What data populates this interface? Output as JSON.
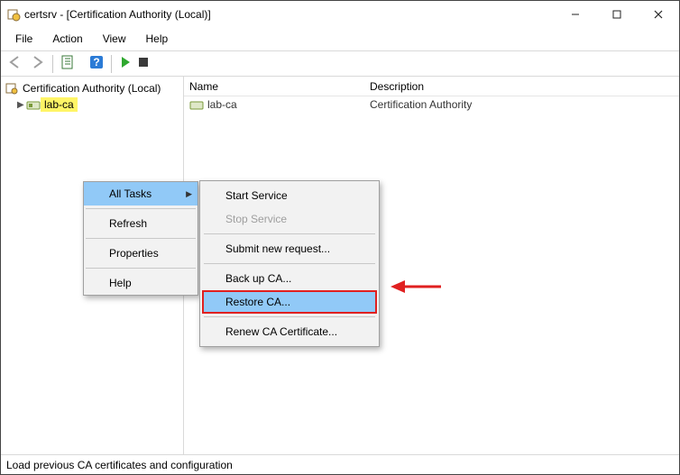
{
  "window": {
    "title": "certsrv - [Certification Authority (Local)]"
  },
  "menubar": {
    "file": "File",
    "action": "Action",
    "view": "View",
    "help": "Help"
  },
  "tree": {
    "root": "Certification Authority (Local)",
    "child": "lab-ca"
  },
  "list": {
    "col_name": "Name",
    "col_desc": "Description",
    "row0_name": "lab-ca",
    "row0_desc": "Certification Authority"
  },
  "ctx1": {
    "all_tasks": "All Tasks",
    "refresh": "Refresh",
    "properties": "Properties",
    "help": "Help"
  },
  "ctx2": {
    "start": "Start Service",
    "stop": "Stop Service",
    "submit": "Submit new request...",
    "backup": "Back up CA...",
    "restore": "Restore CA...",
    "renew": "Renew CA Certificate..."
  },
  "status": {
    "text": "Load previous CA certificates and configuration"
  }
}
